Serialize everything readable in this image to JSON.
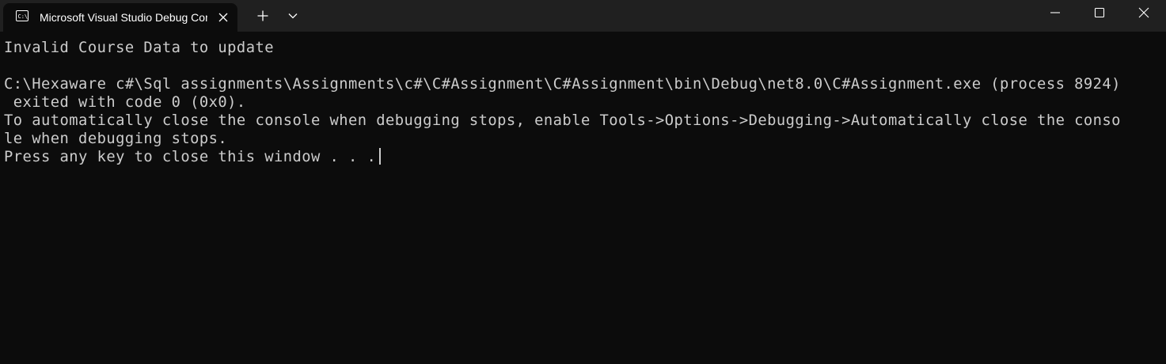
{
  "tab": {
    "title": "Microsoft Visual Studio Debug Console",
    "icon": "console-icon"
  },
  "titlebar": {
    "new_tab_icon": "plus-icon",
    "dropdown_icon": "chevron-down-icon",
    "minimize_icon": "minimize-icon",
    "maximize_icon": "maximize-icon",
    "close_icon": "close-icon"
  },
  "console": {
    "lines": [
      "Invalid Course Data to update",
      "",
      "C:\\Hexaware c#\\Sql assignments\\Assignments\\c#\\C#Assignment\\C#Assignment\\bin\\Debug\\net8.0\\C#Assignment.exe (process 8924)",
      " exited with code 0 (0x0).",
      "To automatically close the console when debugging stops, enable Tools->Options->Debugging->Automatically close the conso",
      "le when debugging stops.",
      "Press any key to close this window . . ."
    ]
  },
  "colors": {
    "background": "#0c0c0c",
    "titlebar": "#202020",
    "text": "#cccccc"
  }
}
